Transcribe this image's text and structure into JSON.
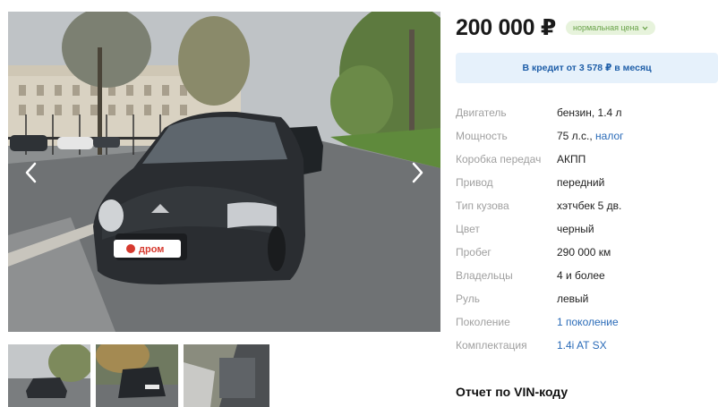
{
  "gallery": {
    "watermark": "дром",
    "prev_icon": "chevron-left-icon",
    "next_icon": "chevron-right-icon",
    "thumbnail_count": 3
  },
  "listing": {
    "price": "200 000 ₽",
    "price_badge": "нормальная цена",
    "credit_text": "В кредит от 3 578 ₽ в месяц",
    "specs": [
      {
        "label": "Двигатель",
        "value": "бензин, 1.4 л"
      },
      {
        "label": "Мощность",
        "value": "75 л.с.,",
        "link": "налог"
      },
      {
        "label": "Коробка передач",
        "value": "АКПП"
      },
      {
        "label": "Привод",
        "value": "передний"
      },
      {
        "label": "Тип кузова",
        "value": "хэтчбек 5 дв."
      },
      {
        "label": "Цвет",
        "value": "черный"
      },
      {
        "label": "Пробег",
        "value": "290 000 км"
      },
      {
        "label": "Владельцы",
        "value": "4 и более"
      },
      {
        "label": "Руль",
        "value": "левый"
      },
      {
        "label": "Поколение",
        "value": "",
        "link": "1 поколение"
      },
      {
        "label": "Комплектация",
        "value": "",
        "link": "1.4i AT SX"
      }
    ],
    "vin_section_title": "Отчет по VIN-коду"
  },
  "colors": {
    "link": "#2a6bb8",
    "badge_green": "#6aa34a",
    "credit_bg": "#e6f1fb"
  }
}
